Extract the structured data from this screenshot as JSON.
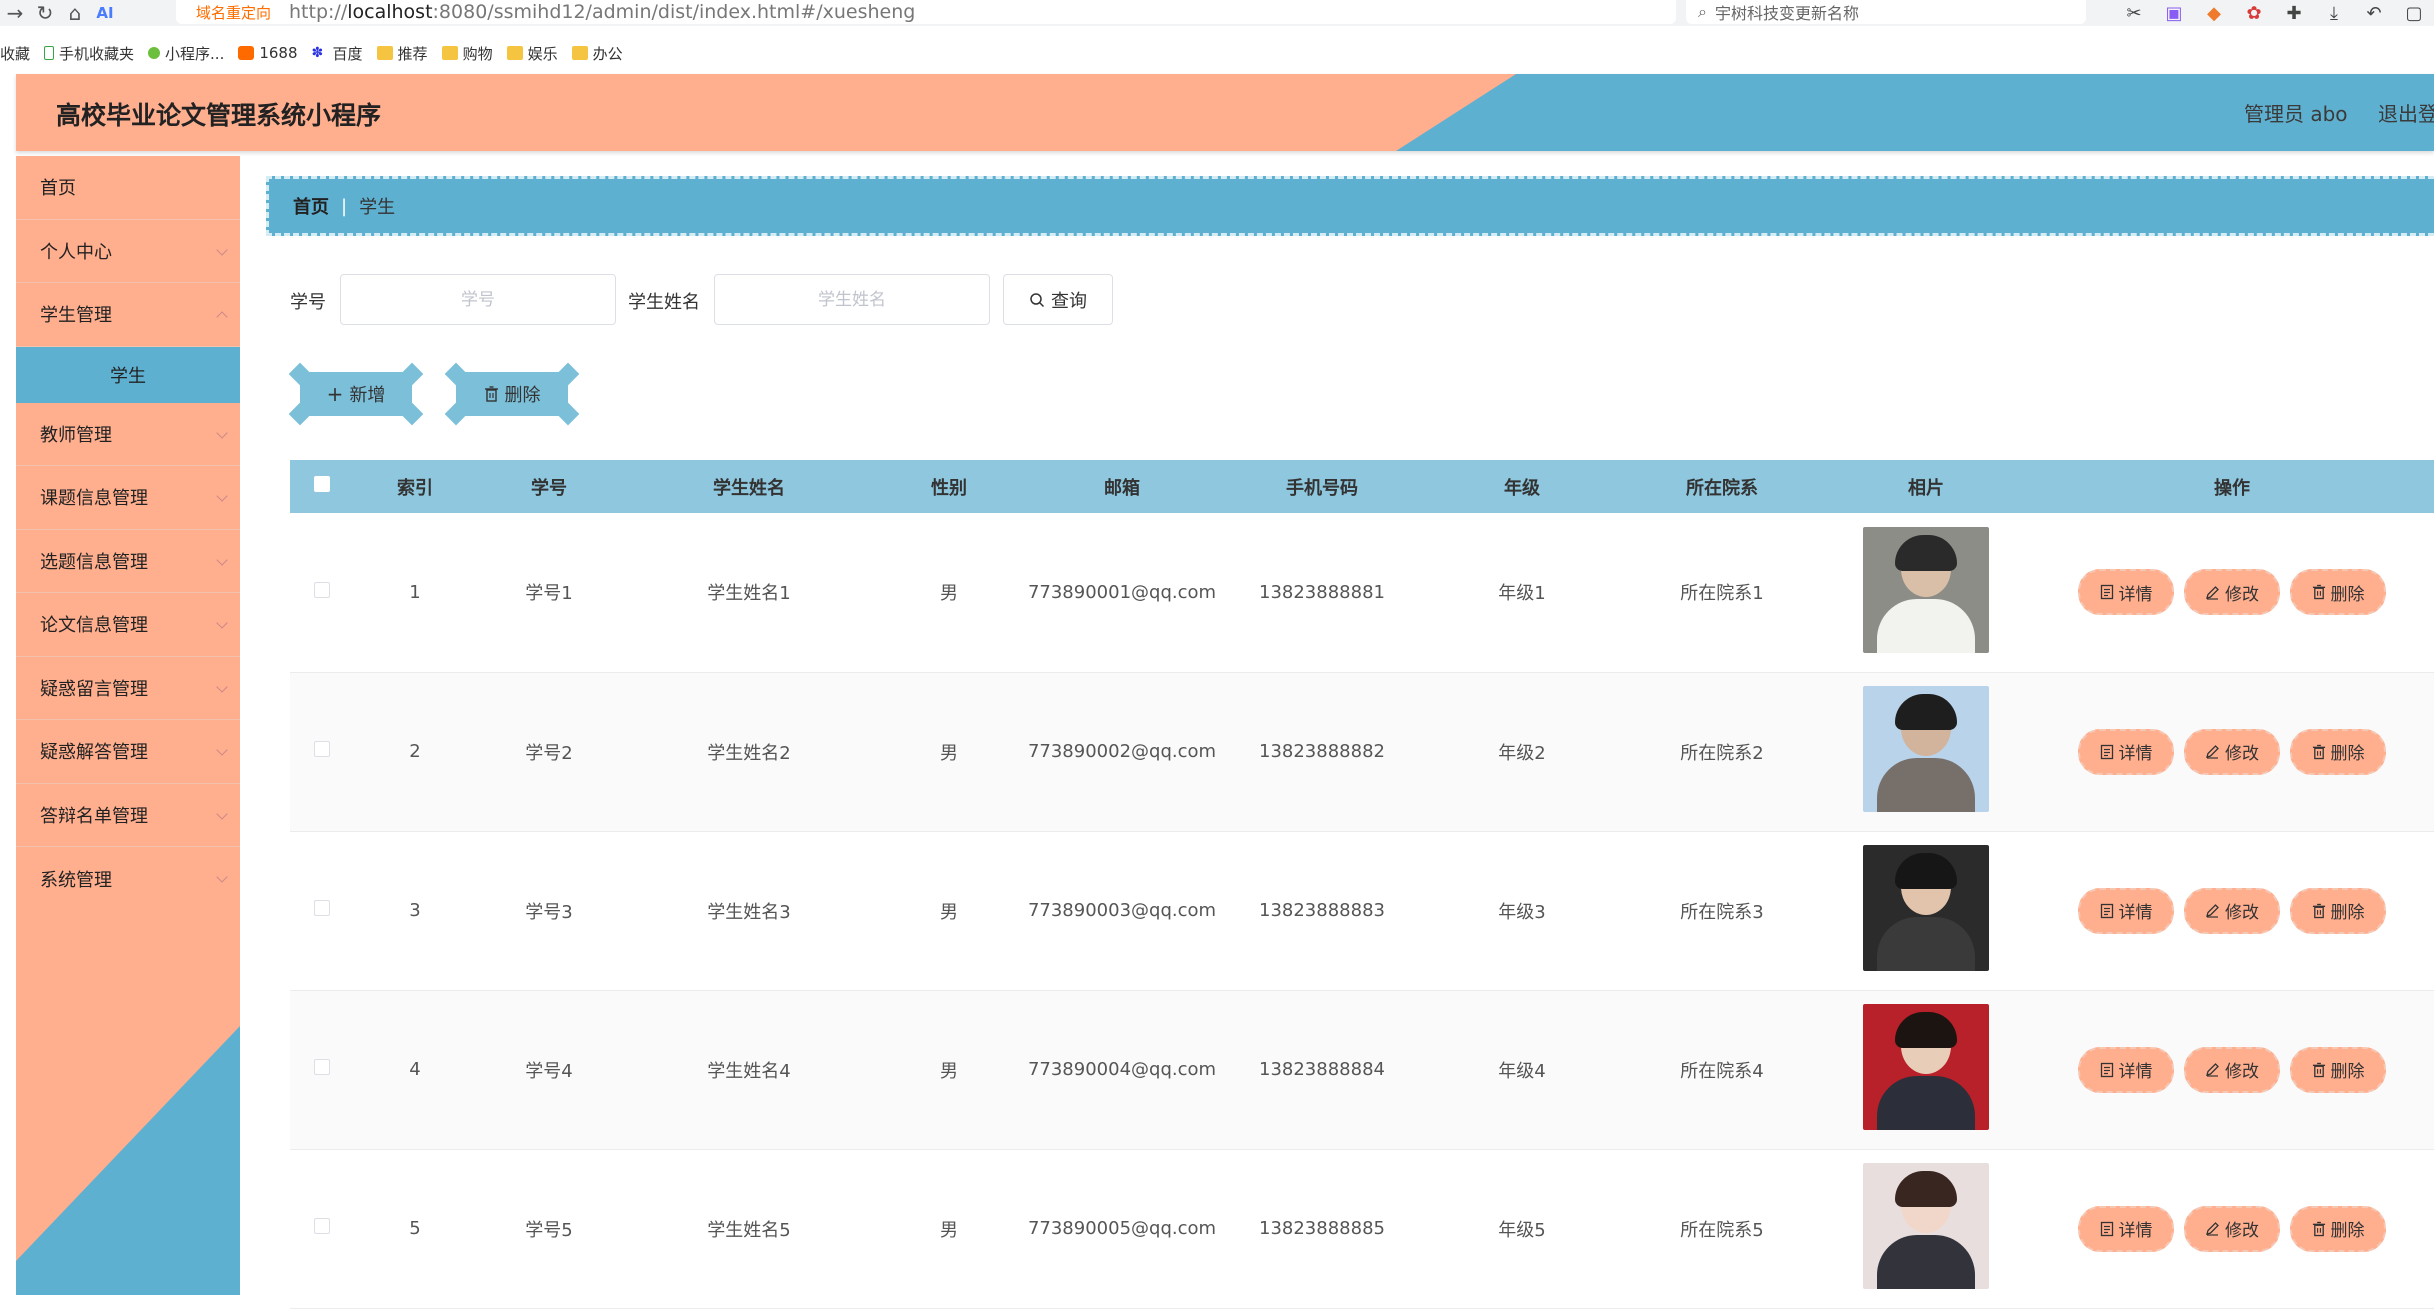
{
  "browser": {
    "redirect_tag": "域名重定向",
    "url_prefix": "http://",
    "url_host": "localhost",
    "url_rest": ":8080/ssmihd12/admin/dist/index.html#/xuesheng",
    "search_placeholder": "宇树科技变更新名称"
  },
  "bookmarks": [
    {
      "label": "收藏"
    },
    {
      "label": "手机收藏夹"
    },
    {
      "label": "小程序..."
    },
    {
      "label": "1688"
    },
    {
      "label": "百度"
    },
    {
      "label": "推荐"
    },
    {
      "label": "购物"
    },
    {
      "label": "娱乐"
    },
    {
      "label": "办公"
    }
  ],
  "header": {
    "title": "高校毕业论文管理系统小程序",
    "admin": "管理员 abo",
    "logout": "退出登"
  },
  "sidebar": {
    "items": [
      {
        "label": "首页",
        "has_arrow": false
      },
      {
        "label": "个人中心",
        "has_arrow": true
      },
      {
        "label": "学生管理",
        "has_arrow": true
      },
      {
        "label": "学生",
        "sub": true
      },
      {
        "label": "教师管理",
        "has_arrow": true
      },
      {
        "label": "课题信息管理",
        "has_arrow": true
      },
      {
        "label": "选题信息管理",
        "has_arrow": true
      },
      {
        "label": "论文信息管理",
        "has_arrow": true
      },
      {
        "label": "疑惑留言管理",
        "has_arrow": true
      },
      {
        "label": "疑惑解答管理",
        "has_arrow": true
      },
      {
        "label": "答辩名单管理",
        "has_arrow": true
      },
      {
        "label": "系统管理",
        "has_arrow": true
      }
    ]
  },
  "breadcrumb": {
    "home": "首页",
    "separator": "|",
    "current": "学生"
  },
  "search": {
    "student_id_label": "学号",
    "student_id_placeholder": "学号",
    "student_id_value": "",
    "student_name_label": "学生姓名",
    "student_name_placeholder": "学生姓名",
    "student_name_value": "",
    "query_button": "查询"
  },
  "actions": {
    "add": "新增",
    "delete": "删除"
  },
  "table": {
    "columns": [
      "索引",
      "学号",
      "学生姓名",
      "性别",
      "邮箱",
      "手机号码",
      "年级",
      "所在院系",
      "相片",
      "操作"
    ],
    "rows": [
      {
        "index": "1",
        "id": "学号1",
        "name": "学生姓名1",
        "gender": "男",
        "email": "773890001@qq.com",
        "phone": "13823888881",
        "grade": "年级1",
        "dept": "所在院系1",
        "photo": "photo-1"
      },
      {
        "index": "2",
        "id": "学号2",
        "name": "学生姓名2",
        "gender": "男",
        "email": "773890002@qq.com",
        "phone": "13823888882",
        "grade": "年级2",
        "dept": "所在院系2",
        "photo": "photo-2"
      },
      {
        "index": "3",
        "id": "学号3",
        "name": "学生姓名3",
        "gender": "男",
        "email": "773890003@qq.com",
        "phone": "13823888883",
        "grade": "年级3",
        "dept": "所在院系3",
        "photo": "photo-3"
      },
      {
        "index": "4",
        "id": "学号4",
        "name": "学生姓名4",
        "gender": "男",
        "email": "773890004@qq.com",
        "phone": "13823888884",
        "grade": "年级4",
        "dept": "所在院系4",
        "photo": "photo-4"
      },
      {
        "index": "5",
        "id": "学号5",
        "name": "学生姓名5",
        "gender": "男",
        "email": "773890005@qq.com",
        "phone": "13823888885",
        "grade": "年级5",
        "dept": "所在院系5",
        "photo": "photo-5"
      }
    ],
    "row_actions": {
      "detail": "详情",
      "edit": "修改",
      "delete": "删除"
    }
  },
  "colors": {
    "peach": "#ffae8e",
    "blue": "#5eb0d1",
    "table_header": "#8ec7de"
  }
}
